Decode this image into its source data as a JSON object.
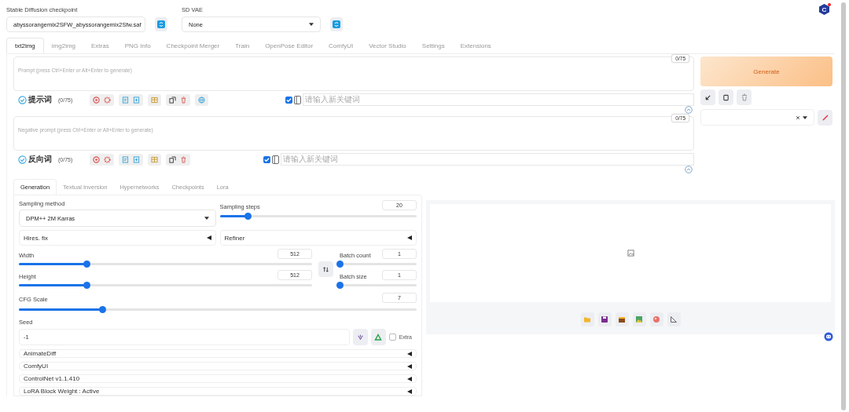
{
  "logo": {
    "letter": "C",
    "notification": true
  },
  "checkpoint": {
    "label": "Stable Diffusion checkpoint",
    "value": "abyssorangemix2SFW_abyssorangemix2Sfw.saf"
  },
  "vae": {
    "label": "SD VAE",
    "value": "None"
  },
  "tabs": [
    {
      "label": "txt2img",
      "selected": true
    },
    {
      "label": "img2img",
      "selected": false
    },
    {
      "label": "Extras",
      "selected": false
    },
    {
      "label": "PNG Info",
      "selected": false
    },
    {
      "label": "Checkpoint Merger",
      "selected": false
    },
    {
      "label": "Train",
      "selected": false
    },
    {
      "label": "OpenPose Editor",
      "selected": false
    },
    {
      "label": "ComfyUI",
      "selected": false
    },
    {
      "label": "Vector Studio",
      "selected": false
    },
    {
      "label": "Settings",
      "selected": false
    },
    {
      "label": "Extensions",
      "selected": false
    }
  ],
  "prompts": [
    {
      "placeholder": "Prompt (press Ctrl+Enter or Alt+Enter to generate)",
      "counter": "0/75",
      "title": "提示词",
      "count": "(0/75)",
      "keyword_enabled": true,
      "keyword_placeholder": "请输入新关键词",
      "globe": true
    },
    {
      "placeholder": "Negative prompt (press Ctrl+Enter or Alt+Enter to generate)",
      "counter": "0/75",
      "title": "反向词",
      "count": "(0/75)",
      "keyword_enabled": true,
      "keyword_placeholder": "请输入新关键词",
      "globe": false
    }
  ],
  "generate": "Generate",
  "sub_tabs": [
    {
      "label": "Generation",
      "selected": true
    },
    {
      "label": "Textual Inversion",
      "selected": false
    },
    {
      "label": "Hypernetworks",
      "selected": false
    },
    {
      "label": "Checkpoints",
      "selected": false
    },
    {
      "label": "Lora",
      "selected": false
    }
  ],
  "sampling_method": {
    "label": "Sampling method",
    "value": "DPM++ 2M Karras"
  },
  "sampling_steps": {
    "label": "Sampling steps",
    "value": "20",
    "level": 0.14
  },
  "hires": {
    "label": "Hires. fix",
    "expanded": false
  },
  "refiner": {
    "label": "Refiner",
    "expanded": false
  },
  "width": {
    "label": "Width",
    "value": "512",
    "level": 0.23
  },
  "height": {
    "label": "Height",
    "value": "512",
    "level": 0.23
  },
  "batch_count": {
    "label": "Batch count",
    "value": "1",
    "level": 0
  },
  "batch_size": {
    "label": "Batch size",
    "value": "1",
    "level": 0
  },
  "cfg": {
    "label": "CFG Scale",
    "value": "7",
    "level": 0.21
  },
  "seed": {
    "label": "Seed",
    "value": "-1",
    "extra_label": "Extra",
    "extra_checked": false
  },
  "accordions": [
    {
      "label": "AnimateDiff",
      "expanded": false
    },
    {
      "label": "ComfyUI",
      "expanded": false
    },
    {
      "label": "ControlNet v1.1.410",
      "expanded": false
    },
    {
      "label": "LoRA Block Weight : Active",
      "expanded": false
    }
  ]
}
